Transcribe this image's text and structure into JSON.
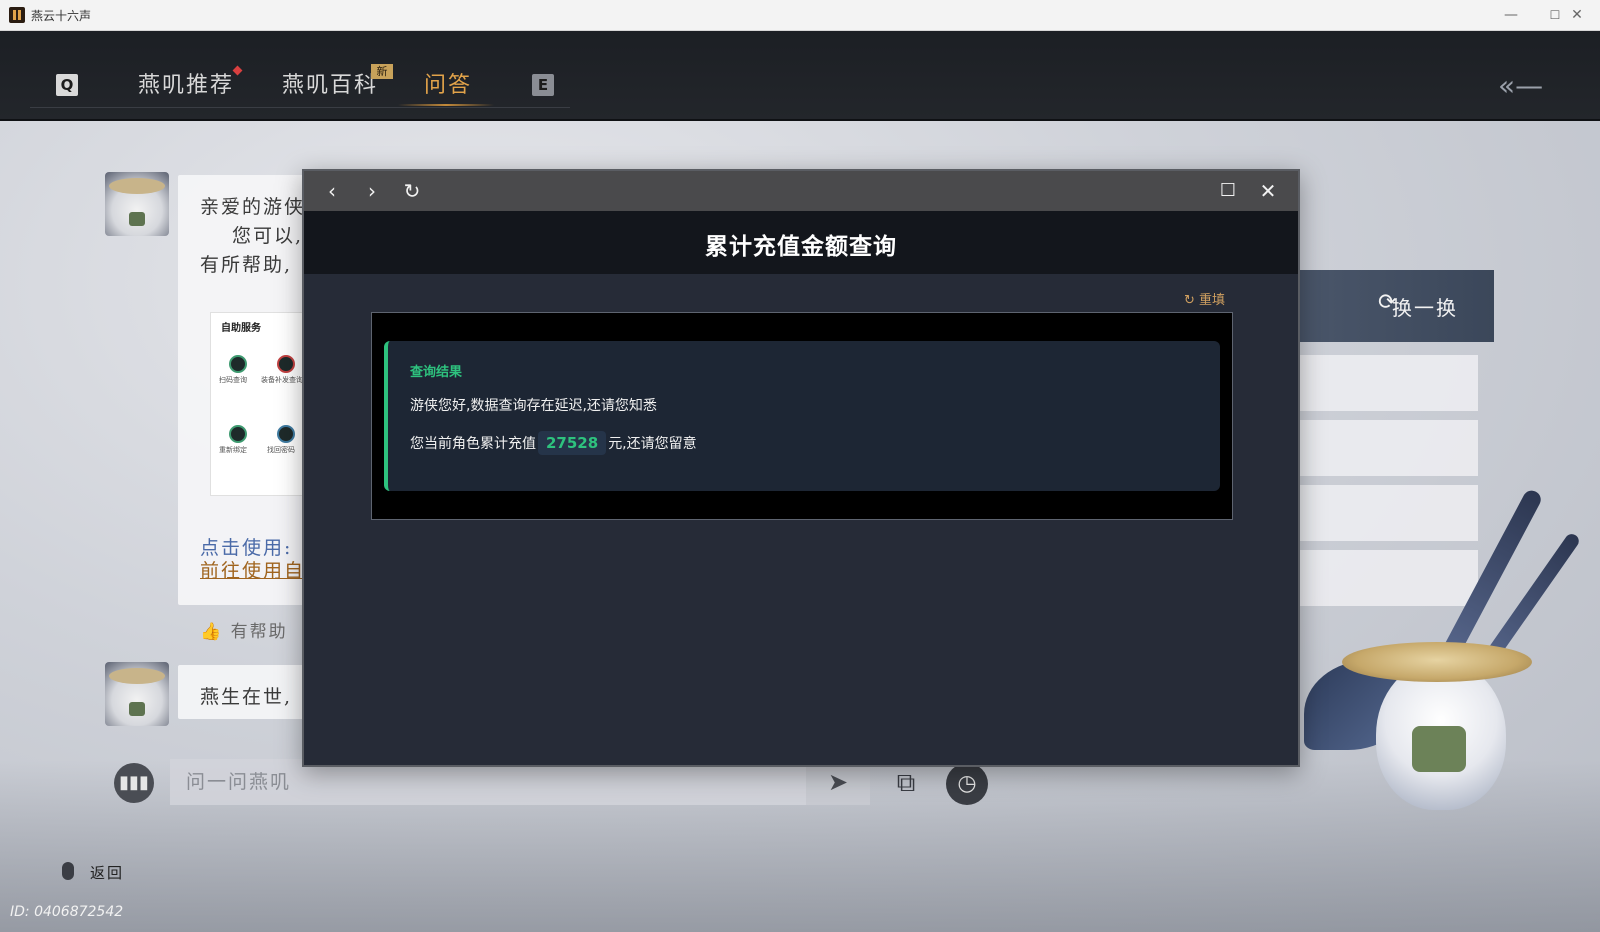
{
  "os_window": {
    "title": "燕云十六声",
    "minimize": "—",
    "maximize": "☐",
    "close": "✕"
  },
  "nav": {
    "key_left": "Q",
    "key_right": "E",
    "tabs": [
      {
        "label": "燕叽推荐",
        "active": false
      },
      {
        "label": "燕叽百科",
        "active": false
      },
      {
        "label": "问答",
        "active": true
      }
    ],
    "new_badge": "新",
    "back_icon": "back-arrow-icon"
  },
  "chat": {
    "message1_lines": [
      "亲爱的游侠",
      "您可以,",
      "有所帮助,"
    ],
    "service_card": {
      "title": "自助服务",
      "labels": [
        "扫码查询",
        "装备补发查询",
        "重新绑定",
        "找回密码"
      ]
    },
    "link_prefix": "点击使用:",
    "link_text": "前往使用自",
    "helpful_label": "有帮助",
    "message2": "燕生在世,"
  },
  "side_panel": {
    "swap_label": "换一换"
  },
  "input_bar": {
    "placeholder": "问一问燕叽",
    "voice_icon": "voice-icon",
    "send_icon": "send-icon",
    "screenshot_icon": "screenshot-icon",
    "history_icon": "clock-icon"
  },
  "footer": {
    "return_label": "返回",
    "player_id": "ID: 0406872542"
  },
  "modal": {
    "title": "累计充值金额查询",
    "reset_label": "重填",
    "result": {
      "heading": "查询结果",
      "line1": "游侠您好,数据查询存在延迟,还请您知悉",
      "line2_prefix": "您当前角色累计充值",
      "amount": "27528",
      "line2_suffix": "元,还请您留意"
    },
    "colors": {
      "accent_green": "#2ec27e",
      "reset_orange": "#d0a060"
    }
  }
}
